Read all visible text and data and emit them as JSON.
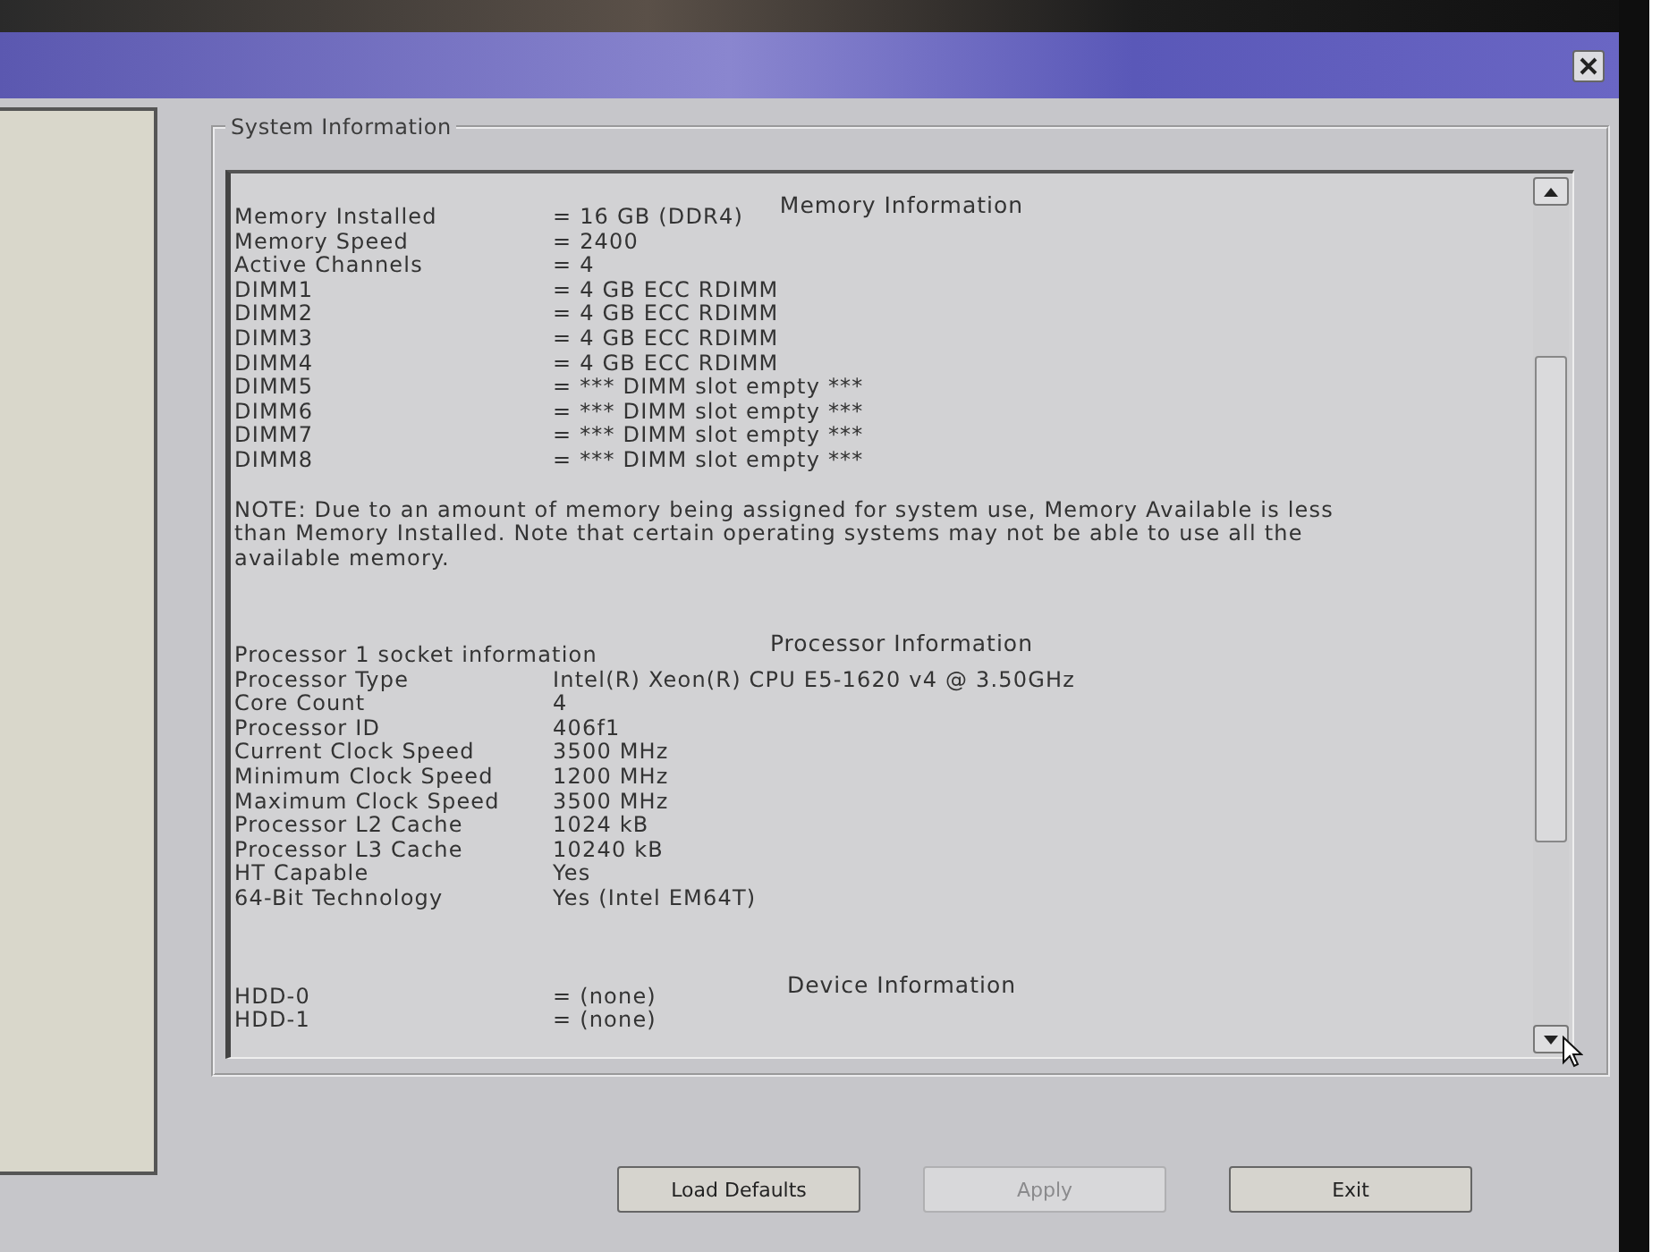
{
  "system_information": {
    "title": "System Information",
    "sections": [
      {
        "heading": "Memory Information",
        "rows": [
          {
            "label": "Memory Installed",
            "value": "= 16 GB (DDR4)"
          },
          {
            "label": "Memory Speed",
            "value": "= 2400"
          },
          {
            "label": "Active Channels",
            "value": "= 4"
          },
          {
            "label": "DIMM1",
            "value": "= 4 GB ECC RDIMM"
          },
          {
            "label": "DIMM2",
            "value": "= 4 GB ECC RDIMM"
          },
          {
            "label": "DIMM3",
            "value": "= 4 GB ECC RDIMM"
          },
          {
            "label": "DIMM4",
            "value": "= 4 GB ECC RDIMM"
          },
          {
            "label": "DIMM5",
            "value": "= *** DIMM slot empty ***"
          },
          {
            "label": "DIMM6",
            "value": "= *** DIMM slot empty ***"
          },
          {
            "label": "DIMM7",
            "value": "= *** DIMM slot empty ***"
          },
          {
            "label": "DIMM8",
            "value": "= *** DIMM slot empty ***"
          }
        ],
        "note": "NOTE: Due to an amount of memory being assigned for system use, Memory Available is less than Memory Installed. Note that certain operating systems may not be able to use all the available memory."
      },
      {
        "heading": "Processor Information",
        "rows": [
          {
            "label": "Processor 1 socket information"
          },
          {
            "label": "Processor Type",
            "value": "Intel(R) Xeon(R) CPU E5-1620 v4 @ 3.50GHz"
          },
          {
            "label": "Core Count",
            "value": "4"
          },
          {
            "label": "Processor ID",
            "value": "406f1"
          },
          {
            "label": "Current Clock Speed",
            "value": "3500 MHz"
          },
          {
            "label": "Minimum Clock Speed",
            "value": "1200 MHz"
          },
          {
            "label": "Maximum Clock Speed",
            "value": "3500 MHz"
          },
          {
            "label": "Processor L2 Cache",
            "value": "1024 kB"
          },
          {
            "label": "Processor L3 Cache",
            "value": "10240 kB"
          },
          {
            "label": "HT Capable",
            "value": "Yes"
          },
          {
            "label": "64-Bit Technology",
            "value": "Yes (Intel EM64T)"
          }
        ]
      },
      {
        "heading": "Device Information",
        "rows": [
          {
            "label": "HDD-0",
            "value": "= (none)"
          },
          {
            "label": "HDD-1",
            "value": "= (none)"
          }
        ]
      }
    ]
  },
  "buttons": [
    {
      "label": "Load Defaults",
      "disabled": false
    },
    {
      "label": "Apply",
      "disabled": true
    },
    {
      "label": "Exit",
      "disabled": false
    }
  ]
}
